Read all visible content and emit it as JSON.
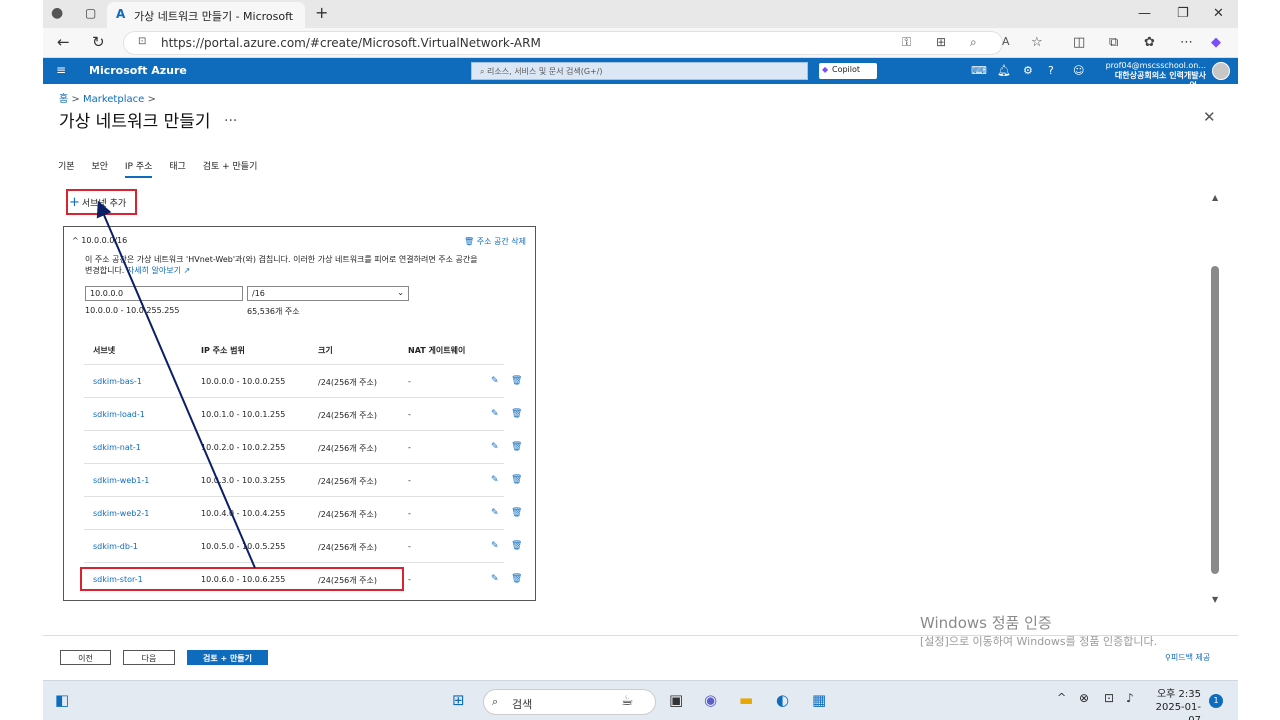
{
  "browser": {
    "tab_title": "가상 네트워크 만들기 - Microsoft",
    "url": "https://portal.azure.com/#create/Microsoft.VirtualNetwork-ARM"
  },
  "azure": {
    "brand": "Microsoft Azure",
    "search_placeholder": "리소스, 서비스 및 문서 검색(G+/)",
    "copilot": "Copilot",
    "user_email": "prof04@mscsschool.on...",
    "user_org": "대한상공회의소 인력개발사업..."
  },
  "breadcrumb": {
    "home": "홈",
    "sep": ">",
    "marketplace": "Marketplace",
    "sep2": ">"
  },
  "page_title": "가상 네트워크 만들기",
  "title_more": "...",
  "tabs": [
    "기본",
    "보안",
    "IP 주소",
    "태그",
    "검토 + 만들기"
  ],
  "add_subnet": "서브넷 추가",
  "address_space": {
    "header": "10.0.0.0/16",
    "delete": "주소 공간 삭제",
    "warning_line1": "이 주소 공간은 가상 네트워크 'HVnet-Web'과(와) 겹칩니다. 이러한 가상 네트워크를 피어로 연결하려면 주소 공간을",
    "warning_line2": "변경합니다.",
    "learn_more": "자세히 알아보기",
    "ip_value": "10.0.0.0",
    "prefix_value": "/16",
    "range": "10.0.0.0 - 10.0.255.255",
    "count": "65,536개 주소"
  },
  "table": {
    "headers": [
      "서브넷",
      "IP 주소 범위",
      "크기",
      "NAT 게이트웨이"
    ],
    "rows": [
      {
        "name": "sdkim-bas-1",
        "range": "10.0.0.0 - 10.0.0.255",
        "size": "/24(256개 주소)",
        "nat": "-"
      },
      {
        "name": "sdkim-load-1",
        "range": "10.0.1.0 - 10.0.1.255",
        "size": "/24(256개 주소)",
        "nat": "-"
      },
      {
        "name": "sdkim-nat-1",
        "range": "10.0.2.0 - 10.0.2.255",
        "size": "/24(256개 주소)",
        "nat": "-"
      },
      {
        "name": "sdkim-web1-1",
        "range": "10.0.3.0 - 10.0.3.255",
        "size": "/24(256개 주소)",
        "nat": "-"
      },
      {
        "name": "sdkim-web2-1",
        "range": "10.0.4.0 - 10.0.4.255",
        "size": "/24(256개 주소)",
        "nat": "-"
      },
      {
        "name": "sdkim-db-1",
        "range": "10.0.5.0 - 10.0.5.255",
        "size": "/24(256개 주소)",
        "nat": "-"
      },
      {
        "name": "sdkim-stor-1",
        "range": "10.0.6.0 - 10.0.6.255",
        "size": "/24(256개 주소)",
        "nat": "-"
      }
    ]
  },
  "footer": {
    "prev": "이전",
    "next": "다음",
    "review": "검토 + 만들기",
    "feedback": "피드백 제공"
  },
  "watermark": {
    "line1": "Windows 정품 인증",
    "line2": "[설정]으로 이동하여 Windows를 정품 인증합니다."
  },
  "taskbar": {
    "search": "검색",
    "time": "오후 2:35",
    "date": "2025-01-07",
    "notifications": "1"
  },
  "colors": {
    "azure_blue": "#0f6cbd",
    "annotation_red": "#d9232e",
    "annotation_arrow": "#0b1f66"
  }
}
